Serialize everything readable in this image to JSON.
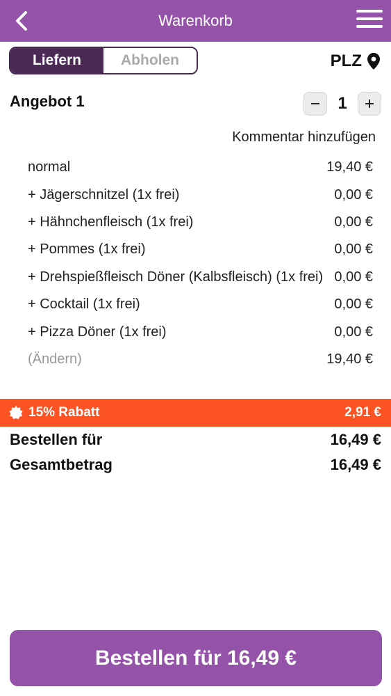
{
  "header": {
    "title": "Warenkorb"
  },
  "delivery_toggle": {
    "options": [
      "Liefern",
      "Abholen"
    ],
    "selected": "Liefern"
  },
  "location": {
    "label": "PLZ"
  },
  "cart_item": {
    "title": "Angebot 1",
    "quantity": "1",
    "comment_link": "Kommentar hinzufügen",
    "lines": [
      {
        "name": "normal",
        "price": "19,40 €"
      },
      {
        "name": "+ Jägerschnitzel (1x frei)",
        "price": "0,00 €"
      },
      {
        "name": "+ Hähnchenfleisch (1x frei)",
        "price": "0,00 €"
      },
      {
        "name": "+ Pommes (1x frei)",
        "price": "0,00 €"
      },
      {
        "name": "+ Drehspießfleisch Döner (Kalbsfleisch) (1x frei)",
        "price": "0,00 €"
      },
      {
        "name": "+ Cocktail (1x frei)",
        "price": "0,00 €"
      },
      {
        "name": "+ Pizza Döner (1x frei)",
        "price": "0,00 €"
      }
    ],
    "change_label": "(Ändern)",
    "subtotal": "19,40 €"
  },
  "discount": {
    "label": "15% Rabatt",
    "amount": "2,91 €",
    "color": "#fb5323"
  },
  "summary": {
    "order_for_label": "Bestellen für",
    "order_for_value": "16,49 €",
    "total_label": "Gesamtbetrag",
    "total_value": "16,49 €"
  },
  "order_button": {
    "label": "Bestellen für 16,49 €"
  },
  "colors": {
    "header": "#9453a8",
    "toggle_active": "#4a2a55",
    "discount": "#fb5323"
  }
}
